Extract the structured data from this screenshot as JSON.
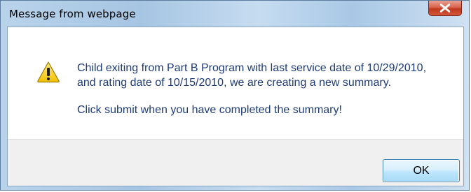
{
  "dialog": {
    "title": "Message from webpage",
    "close_icon": "close-icon",
    "warning_icon": "warning-icon",
    "message": {
      "line1": "Child exiting from Part B Program with last service date of 10/29/2010,",
      "line2": "and rating date of 10/15/2010, we are creating a new summary.",
      "line3": "Click submit when you have completed the summary!"
    },
    "ok_label": "OK"
  },
  "colors": {
    "message_text": "#1e3b78",
    "close_button": "#c0391e",
    "ok_button_border": "#3c7fb1"
  }
}
